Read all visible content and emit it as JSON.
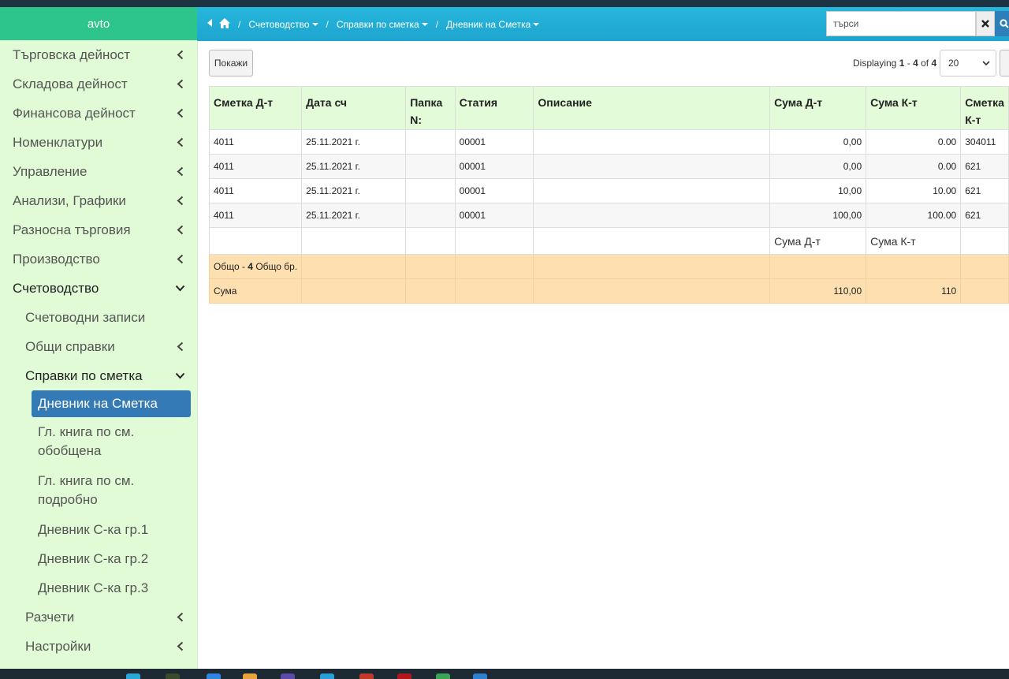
{
  "app": {
    "brand": "avto"
  },
  "sidebar": {
    "items": [
      {
        "label": "Търговска дейност",
        "level": 1,
        "chevron": "left"
      },
      {
        "label": "Складова дейност",
        "level": 1,
        "chevron": "left"
      },
      {
        "label": "Финансова дейност",
        "level": 1,
        "chevron": "left"
      },
      {
        "label": "Номенклатури",
        "level": 1,
        "chevron": "left"
      },
      {
        "label": "Управление",
        "level": 1,
        "chevron": "left"
      },
      {
        "label": "Анализи, Графики",
        "level": 1,
        "chevron": "left"
      },
      {
        "label": "Разносна търговия",
        "level": 1,
        "chevron": "left"
      },
      {
        "label": "Производство",
        "level": 1,
        "chevron": "left"
      },
      {
        "label": "Счетоводство",
        "level": 1,
        "chevron": "down"
      },
      {
        "label": "Счетоводни записи",
        "level": 2
      },
      {
        "label": "Общи справки",
        "level": 2,
        "chevron": "left"
      },
      {
        "label": "Справки по сметка",
        "level": 2,
        "chevron": "down"
      },
      {
        "label": "Дневник на Сметка",
        "level": 3,
        "active": true
      },
      {
        "label": "Гл. книга по см.",
        "label2": "обобщена",
        "level": 3
      },
      {
        "label": "Гл. книга по см.",
        "label2": "подробно",
        "level": 3
      },
      {
        "label": "Дневник С-ка гр.1",
        "level": 3
      },
      {
        "label": "Дневник С-ка гр.2",
        "level": 3
      },
      {
        "label": "Дневник С-ка гр.3",
        "level": 3
      },
      {
        "label": "Разчети",
        "level": 2,
        "chevron": "left"
      },
      {
        "label": "Настройки",
        "level": 2,
        "chevron": "left"
      }
    ]
  },
  "header": {
    "breadcrumbs": [
      "Счетоводство",
      "Справки по сметка",
      "Дневник на Сметка"
    ],
    "search_placeholder": "търси",
    "colors": {
      "bar": "#1ea5cf",
      "accent": "#2d7fb9",
      "brand": "#2ec58c"
    }
  },
  "toolbar": {
    "show_label": "Покажи",
    "displaying_prefix": "Displaying ",
    "range_from": "1",
    "range_sep": " - ",
    "range_to": "4",
    "of_label": " of ",
    "total": "4",
    "page_size": "20"
  },
  "table": {
    "columns": [
      "Сметка Д-т",
      "Дата сч",
      "Папка N:",
      "Статия",
      "Описание",
      "Сума Д-т",
      "Сума К-т",
      "Сметка К-т"
    ],
    "rows": [
      {
        "account_dt": "4011",
        "date": "25.11.2021 г.",
        "folder": "",
        "article": "00001",
        "description": "",
        "sum_dt": "0,00",
        "sum_kt": "0.00",
        "account_kt": "304011"
      },
      {
        "account_dt": "4011",
        "date": "25.11.2021 г.",
        "folder": "",
        "article": "00001",
        "description": "",
        "sum_dt": "0,00",
        "sum_kt": "0.00",
        "account_kt": "621"
      },
      {
        "account_dt": "4011",
        "date": "25.11.2021 г.",
        "folder": "",
        "article": "00001",
        "description": "",
        "sum_dt": "10,00",
        "sum_kt": "10.00",
        "account_kt": "621"
      },
      {
        "account_dt": "4011",
        "date": "25.11.2021 г.",
        "folder": "",
        "article": "00001",
        "description": "",
        "sum_dt": "100,00",
        "sum_kt": "100.00",
        "account_kt": "621"
      }
    ],
    "subheader": {
      "sum_dt": "Сума Д-т",
      "sum_kt": "Сума К-т"
    },
    "total_row": {
      "prefix": "Общо - ",
      "count": "4",
      "suffix": " Общо бр."
    },
    "sum_row": {
      "label": "Сума",
      "sum_dt": "110,00",
      "sum_kt": "110"
    }
  }
}
